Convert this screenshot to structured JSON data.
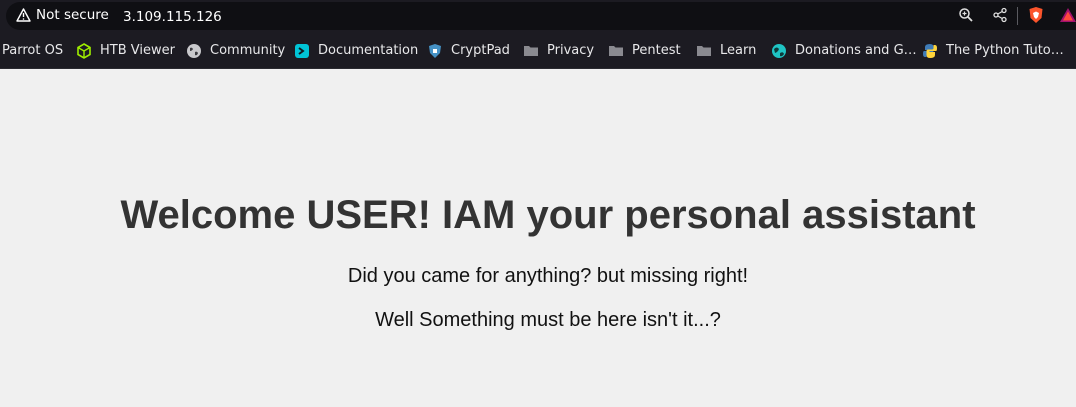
{
  "browser": {
    "security_label": "Not secure",
    "url": "3.109.115.126",
    "icons": [
      "zoom-icon",
      "share-icon",
      "brave-shield-icon",
      "brave-rewards-icon"
    ]
  },
  "bookmarks": [
    {
      "label": "Parrot OS",
      "icon": "none"
    },
    {
      "label": "HTB Viewer",
      "icon": "green-cube-icon"
    },
    {
      "label": "Community",
      "icon": "globe-icon"
    },
    {
      "label": "Documentation",
      "icon": "doc-app-icon"
    },
    {
      "label": "CryptPad",
      "icon": "shield-icon"
    },
    {
      "label": "Privacy",
      "icon": "folder-icon"
    },
    {
      "label": "Pentest",
      "icon": "folder-icon"
    },
    {
      "label": "Learn",
      "icon": "folder-icon"
    },
    {
      "label": "Donations and G…",
      "icon": "earth-icon"
    },
    {
      "label": "The Python Tuto…",
      "icon": "python-icon"
    }
  ],
  "page": {
    "heading": "Welcome USER! IAM your personal assistant",
    "line1": "Did you came for anything? but missing right!",
    "line2": "Well Something must be here isn't it...?"
  },
  "colors": {
    "chrome_bg": "#1c1b22",
    "url_bg": "#0f0f13",
    "page_bg": "#f0f0f0",
    "heading": "#333333",
    "text": "#111111"
  }
}
